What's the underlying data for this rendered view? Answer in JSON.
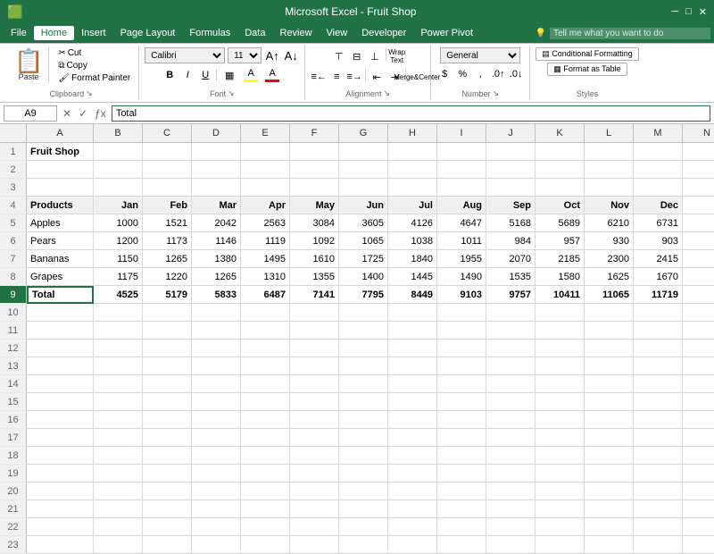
{
  "title": "Microsoft Excel - Fruit Shop",
  "menu": {
    "items": [
      "File",
      "Home",
      "Insert",
      "Page Layout",
      "Formulas",
      "Data",
      "Review",
      "View",
      "Developer",
      "Power Pivot"
    ],
    "active": "Home",
    "tell": "Tell me what you want to do"
  },
  "ribbon": {
    "groups": {
      "clipboard": {
        "label": "Clipboard",
        "paste": "Paste",
        "copy": "Copy",
        "cut": "Cut",
        "format_painter": "Format Painter"
      },
      "font": {
        "label": "Font",
        "font_name": "Calibri",
        "font_size": "11",
        "bold": "B",
        "italic": "I",
        "underline": "U"
      },
      "alignment": {
        "label": "Alignment",
        "wrap_text": "Wrap Text",
        "merge": "Merge & Center"
      },
      "number": {
        "label": "Number",
        "format": "General"
      },
      "styles": {
        "label": "Styles",
        "conditional": "Conditional Formatting",
        "format_table": "Format as Table"
      }
    }
  },
  "formula_bar": {
    "cell_ref": "A9",
    "formula": "Total"
  },
  "columns": [
    "A",
    "B",
    "C",
    "D",
    "E",
    "F",
    "G",
    "H",
    "I",
    "J",
    "K",
    "L",
    "M",
    "N"
  ],
  "col_headers": [
    "",
    "A",
    "B",
    "C",
    "D",
    "E",
    "F",
    "G",
    "H",
    "I",
    "J",
    "K",
    "L",
    "M",
    "N"
  ],
  "spreadsheet": {
    "title_row": 1,
    "title": "Fruit Shop",
    "header_row": 4,
    "headers": [
      "Products",
      "Jan",
      "Feb",
      "Mar",
      "Apr",
      "May",
      "Jun",
      "Jul",
      "Aug",
      "Sep",
      "Oct",
      "Nov",
      "Dec"
    ],
    "data": [
      {
        "row": 5,
        "label": "Apples",
        "values": [
          1000,
          1521,
          2042,
          2563,
          3084,
          3605,
          4126,
          4647,
          5168,
          5689,
          6210,
          6731
        ]
      },
      {
        "row": 6,
        "label": "Pears",
        "values": [
          1200,
          1173,
          1146,
          1119,
          1092,
          1065,
          1038,
          1011,
          984,
          957,
          930,
          903
        ]
      },
      {
        "row": 7,
        "label": "Bananas",
        "values": [
          1150,
          1265,
          1380,
          1495,
          1610,
          1725,
          1840,
          1955,
          2070,
          2185,
          2300,
          2415
        ]
      },
      {
        "row": 8,
        "label": "Grapes",
        "values": [
          1175,
          1220,
          1265,
          1310,
          1355,
          1400,
          1445,
          1490,
          1535,
          1580,
          1625,
          1670
        ]
      }
    ],
    "totals": {
      "row": 9,
      "label": "Total",
      "values": [
        4525,
        5179,
        5833,
        6487,
        7141,
        7795,
        8449,
        9103,
        9757,
        10411,
        11065,
        11719
      ]
    }
  },
  "selected_cell": "A9"
}
